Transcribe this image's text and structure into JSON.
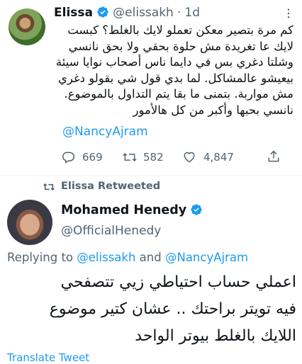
{
  "tweet1": {
    "author_name": "Elissa",
    "author_handle": "@elissakh",
    "separator": "·",
    "time": "1d",
    "text_lines": [
      "كم مرة بتصير معكن تعملو لايك بالغلط؟ كبست",
      "لايك عا تغريدة مش حلوة بحقي ولا بحق نانسي",
      "وشلتا دغري بس في دايما ناس أصحاب نوايا سيئة",
      "بيعيشو عالمشاكل. لما بدي قول شي بقولو دغري",
      "مش مواربة. بتمنى ما بقا يتم التداول بالموضوع.",
      "نانسي بحبها وأكبر من كل هالأمور"
    ],
    "mention": "@NancyAjram",
    "replies": "669",
    "retweets": "582",
    "likes": "4,847"
  },
  "retweet_banner": "Elissa Retweeted",
  "tweet2": {
    "author_name": "Mohamed Henedy",
    "author_handle": "@OfficialHenedy",
    "replying_prefix": "Replying to",
    "replying_user1": "@elissakh",
    "replying_and": "and",
    "replying_user2": "@NancyAjram",
    "text_lines": [
      "اعملي حساب احتياطي زيي تتصفحي",
      "فيه تويتر براحتك .. عشان كتير موضوع",
      "اللايك بالغلط بيوتر الواحد"
    ],
    "translate": "Translate Tweet"
  },
  "colors": {
    "accent": "#1d9bf0",
    "muted": "#536471",
    "text": "#0f1419"
  },
  "icons": [
    "verified-badge-icon",
    "more-icon",
    "reply-icon",
    "retweet-icon",
    "like-icon",
    "share-icon"
  ]
}
